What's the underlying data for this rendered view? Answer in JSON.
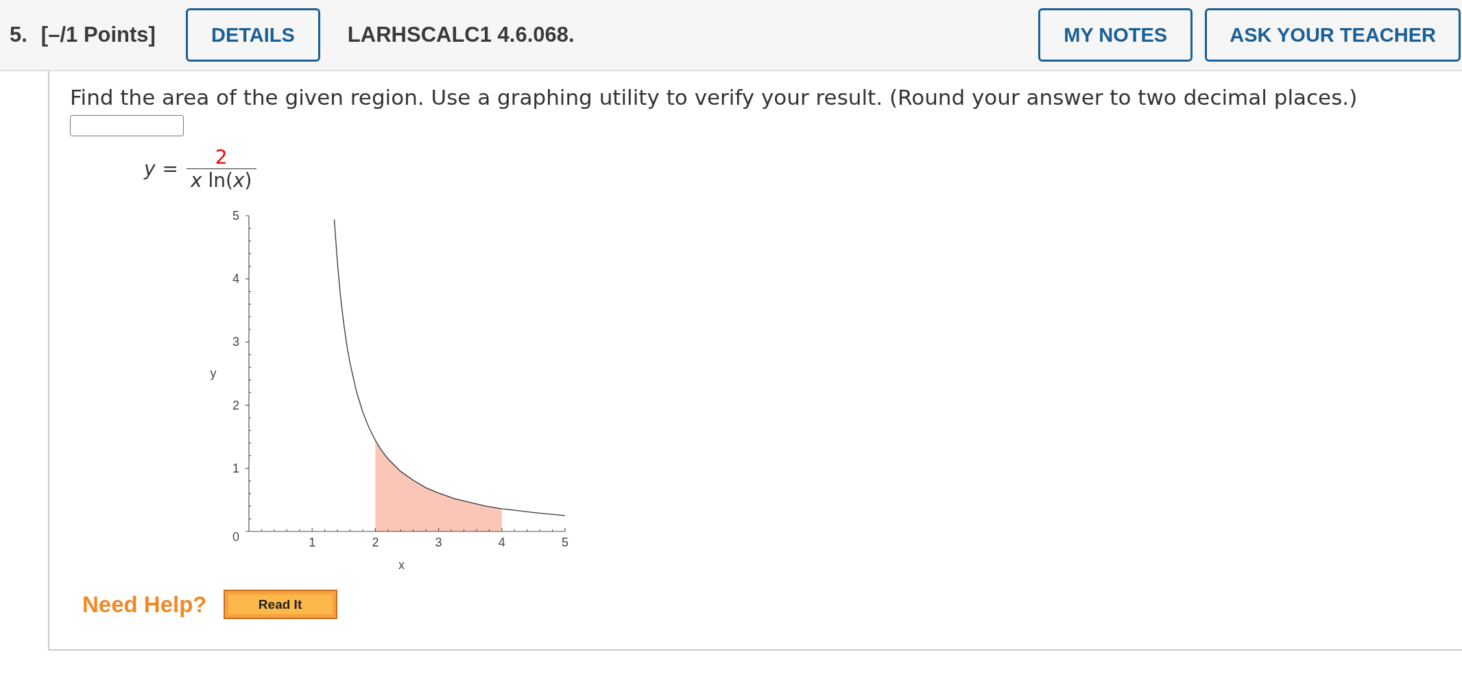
{
  "header": {
    "number": "5.",
    "points": "[–/1 Points]",
    "details_button": "DETAILS",
    "problem_id": "LARHSCALC1 4.6.068.",
    "buttons": [
      "MY NOTES",
      "ASK YOUR TEACHER"
    ]
  },
  "question": {
    "prompt": "Find the area of the given region. Use a graphing utility to verify your result. (Round your answer to two decimal places.)",
    "equation": {
      "lhs": "y",
      "sign": "=",
      "numerator": "2",
      "denominator": "*x* ln(*x*)"
    },
    "chart_data": {
      "type": "line",
      "xlabel": "x",
      "ylabel": "y",
      "xlim": [
        0,
        5
      ],
      "ylim": [
        0,
        5
      ],
      "xticks": [
        {
          "value": 1,
          "label": "1"
        },
        {
          "value": 2,
          "label": "2"
        },
        {
          "value": 3,
          "label": "3"
        },
        {
          "value": 4,
          "label": "4"
        },
        {
          "value": 5,
          "label": "5"
        }
      ],
      "yticks": [
        0,
        1,
        2,
        3,
        4,
        5
      ],
      "x": [
        1.35,
        1.4,
        1.45,
        1.5,
        1.55,
        1.6,
        1.7,
        1.8,
        1.9,
        2,
        2.1,
        2.2,
        2.4,
        2.6,
        2.8,
        3,
        3.25,
        3.5,
        3.75,
        4,
        4.5,
        5
      ],
      "series": [
        {
          "type": "area",
          "color": "#f9c6b7",
          "values": [
            null,
            null,
            null,
            null,
            null,
            null,
            null,
            null,
            null,
            1.44,
            1.28,
            1.15,
            0.95,
            0.81,
            0.69,
            0.61,
            0.52,
            0.46,
            0.4,
            0.36,
            null,
            null
          ]
        },
        {
          "color": "#333333",
          "values": [
            4.94,
            4.25,
            3.71,
            3.29,
            2.94,
            2.66,
            2.22,
            1.89,
            1.64,
            1.44,
            1.28,
            1.15,
            0.95,
            0.81,
            0.69,
            0.61,
            0.52,
            0.46,
            0.4,
            0.36,
            0.3,
            0.25
          ]
        }
      ]
    },
    "help": {
      "label": "Need Help?",
      "buttons": [
        "Read It"
      ]
    }
  }
}
